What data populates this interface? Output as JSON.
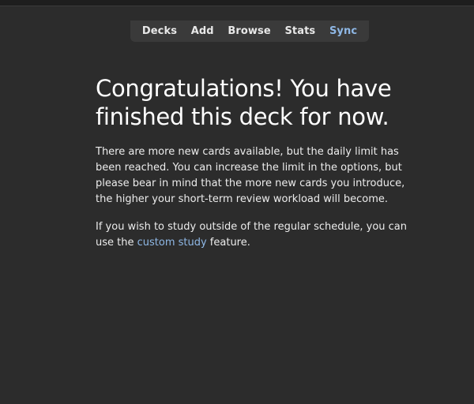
{
  "toolbar": {
    "items": [
      {
        "label": "Decks"
      },
      {
        "label": "Add"
      },
      {
        "label": "Browse"
      },
      {
        "label": "Stats"
      },
      {
        "label": "Sync"
      }
    ]
  },
  "congrats": {
    "title": "Congratulations! You have finished this deck for now.",
    "limit_message": "There are more new cards available, but the daily limit has been reached. You can increase the limit in the options, but please bear in mind that the more new cards you introduce, the higher your short-term review workload will become.",
    "study_prefix": "If you wish to study outside of the regular schedule, you can use the ",
    "study_link": "custom study",
    "study_suffix": " feature."
  },
  "colors": {
    "background": "#2c2c2c",
    "toolbar_bg": "#3a3a3a",
    "link": "#8fb8e6",
    "text": "#ececec"
  }
}
